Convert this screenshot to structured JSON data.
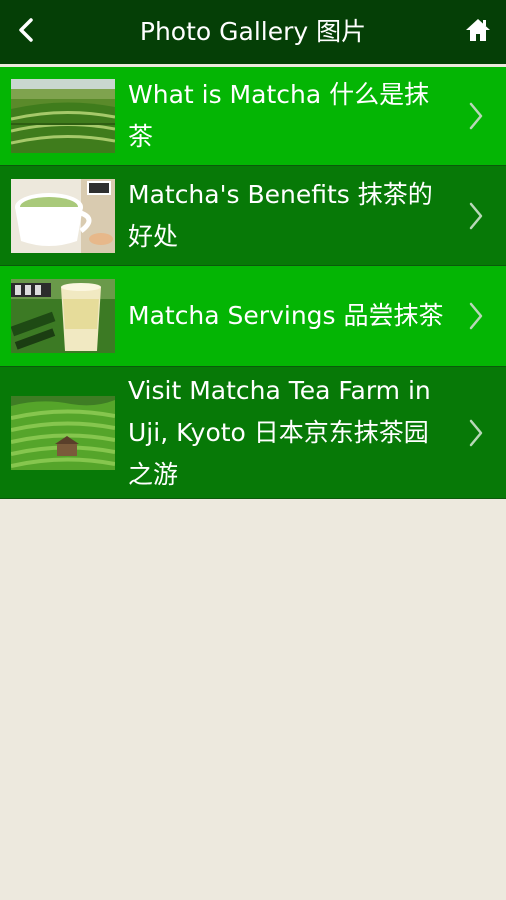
{
  "header": {
    "title": "Photo Gallery 图片",
    "back_icon": "chevron-left-icon",
    "home_icon": "home-icon"
  },
  "colors": {
    "topbar": "#053f06",
    "row_light": "#04b504",
    "row_dark": "#077907",
    "background": "#ede9de"
  },
  "gallery": {
    "items": [
      {
        "label": "What is Matcha 什么是抹茶",
        "thumbnail": "tea-field-photo"
      },
      {
        "label": "Matcha's Benefits 抹茶的好处",
        "thumbnail": "matcha-latte-cup-photo"
      },
      {
        "label": "Matcha Servings 品尝抹茶",
        "thumbnail": "iced-matcha-drink-photo"
      },
      {
        "label": "Visit Matcha Tea Farm in Uji, Kyoto 日本京东抹茶园之游",
        "thumbnail": "uji-tea-farm-photo"
      }
    ]
  }
}
